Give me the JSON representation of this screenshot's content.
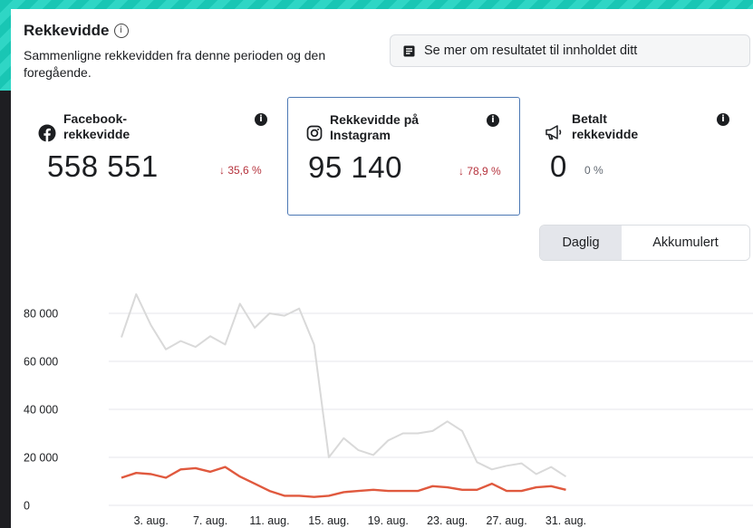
{
  "header": {
    "title": "Rekkevidde",
    "info_symbol": "i",
    "subtitle": "Sammenligne rekkevidden fra denne perioden og den foregående.",
    "see_more_label": "Se mer om resultatet til innholdet ditt"
  },
  "metrics": [
    {
      "label": "Facebook-rekkevidde",
      "value": "558 551",
      "change": "↓ 35,6 %",
      "icon": "facebook-icon",
      "selected": false
    },
    {
      "label": "Rekkevidde på Instagram",
      "value": "95 140",
      "change": "↓ 78,9 %",
      "icon": "instagram-icon",
      "selected": true
    },
    {
      "label": "Betalt rekkevidde",
      "value": "0",
      "change": "0 %",
      "icon": "megaphone-icon",
      "selected": false
    }
  ],
  "toggle": {
    "daily": "Daglig",
    "cumulative": "Akkumulert",
    "active": "Daglig"
  },
  "colors": {
    "previous_period": "#d9d9d9",
    "current_period": "#e0593e",
    "selected_border": "#4c78b4",
    "decline": "#b5323c"
  },
  "chart_data": {
    "type": "line",
    "x": [
      "1. aug.",
      "2. aug.",
      "3. aug.",
      "4. aug.",
      "5. aug.",
      "6. aug.",
      "7. aug.",
      "8. aug.",
      "9. aug.",
      "10. aug.",
      "11. aug.",
      "12. aug.",
      "13. aug.",
      "14. aug.",
      "15. aug.",
      "16. aug.",
      "17. aug.",
      "18. aug.",
      "19. aug.",
      "20. aug.",
      "21. aug.",
      "22. aug.",
      "23. aug.",
      "24. aug.",
      "25. aug.",
      "26. aug.",
      "27. aug.",
      "28. aug.",
      "29. aug.",
      "30. aug.",
      "31. aug."
    ],
    "x_tick_labels": [
      "3. aug.",
      "7. aug.",
      "11. aug.",
      "15. aug.",
      "19. aug.",
      "23. aug.",
      "27. aug.",
      "31. aug."
    ],
    "y_ticks": [
      "0",
      "20 000",
      "40 000",
      "60 000",
      "80 000"
    ],
    "ylim": [
      0,
      90000
    ],
    "grid": true,
    "series": [
      {
        "color": "#d9d9d9",
        "values": [
          70000,
          88000,
          75000,
          65000,
          68500,
          66000,
          70500,
          67000,
          84000,
          74000,
          80000,
          79000,
          82000,
          67000,
          20000,
          28000,
          23000,
          21000,
          27000,
          30000,
          30000,
          31000,
          35000,
          31000,
          18000,
          15000,
          16500,
          17500,
          13000,
          16000,
          12000
        ]
      },
      {
        "color": "#e0593e",
        "values": [
          11500,
          13500,
          13000,
          11500,
          15000,
          15500,
          14000,
          16000,
          12000,
          9000,
          6000,
          4000,
          4000,
          3500,
          4000,
          5500,
          6000,
          6500,
          6000,
          6000,
          6000,
          8000,
          7500,
          6500,
          6500,
          9000,
          6000,
          6000,
          7500,
          8000,
          6500
        ]
      }
    ]
  }
}
